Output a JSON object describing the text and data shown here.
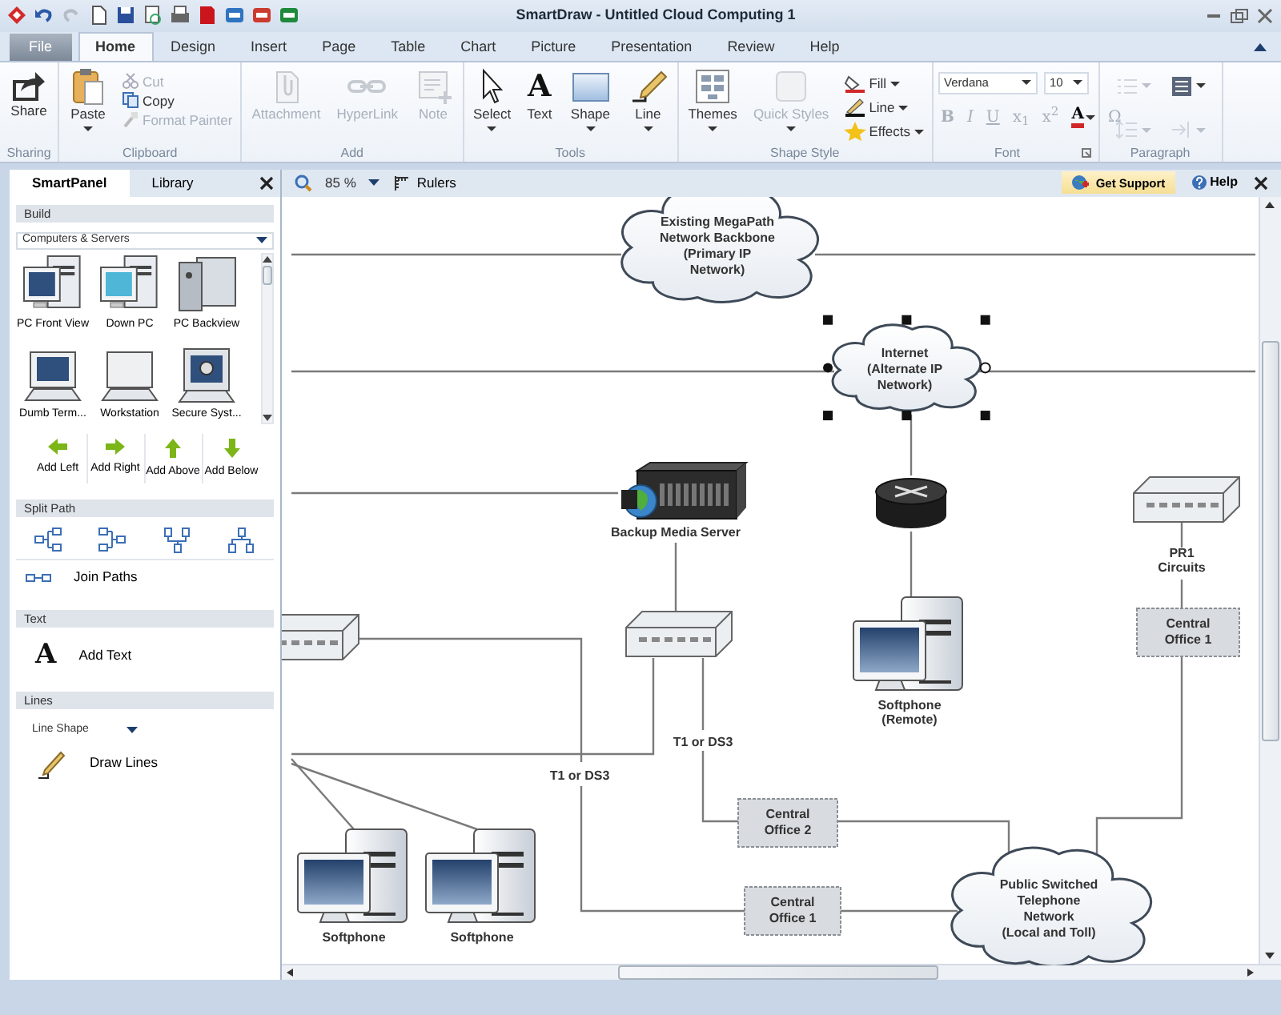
{
  "window": {
    "title": "SmartDraw - Untitled Cloud Computing 1"
  },
  "ribbon_tabs": [
    {
      "kind": "menu",
      "label": "File",
      "selected": false
    },
    {
      "kind": "tab",
      "label": "Home",
      "selected": true
    },
    {
      "kind": "tab",
      "label": "Design",
      "selected": false
    },
    {
      "kind": "tab",
      "label": "Insert",
      "selected": false
    },
    {
      "kind": "tab",
      "label": "Page",
      "selected": false
    },
    {
      "kind": "tab",
      "label": "Table",
      "selected": false
    },
    {
      "kind": "tab",
      "label": "Chart",
      "selected": false
    },
    {
      "kind": "tab",
      "label": "Picture",
      "selected": false
    },
    {
      "kind": "tab",
      "label": "Presentation",
      "selected": false
    },
    {
      "kind": "tab",
      "label": "Review",
      "selected": false
    },
    {
      "kind": "tab",
      "label": "Help",
      "selected": false
    }
  ],
  "ribbon_groups": [
    {
      "label": "Sharing",
      "items": [
        {
          "kind": "large",
          "label": "Share",
          "disabled": false,
          "dropdown": false
        }
      ]
    },
    {
      "label": "Clipboard",
      "items": [
        {
          "kind": "large",
          "label": "Paste",
          "disabled": false,
          "dropdown": true
        },
        {
          "kind": "small",
          "label": "Cut",
          "disabled": true,
          "dropdown": false
        },
        {
          "kind": "small",
          "label": "Copy",
          "disabled": false,
          "dropdown": false
        },
        {
          "kind": "small",
          "label": "Format Painter",
          "disabled": true,
          "dropdown": false
        }
      ]
    },
    {
      "label": "Add",
      "items": [
        {
          "kind": "large",
          "label": "Attachment",
          "disabled": true,
          "dropdown": false
        },
        {
          "kind": "large",
          "label": "HyperLink",
          "disabled": true,
          "dropdown": false
        },
        {
          "kind": "large",
          "label": "Note",
          "disabled": true,
          "dropdown": false
        }
      ]
    },
    {
      "label": "Tools",
      "items": [
        {
          "kind": "large",
          "label": "Select",
          "disabled": false,
          "dropdown": true
        },
        {
          "kind": "large",
          "label": "Text",
          "glyph": "A",
          "disabled": false,
          "dropdown": false
        },
        {
          "kind": "large",
          "label": "Shape",
          "disabled": false,
          "dropdown": true
        },
        {
          "kind": "large",
          "label": "Line",
          "disabled": false,
          "dropdown": true
        }
      ]
    },
    {
      "label": "Shape Style",
      "items": [
        {
          "kind": "large",
          "label": "Themes",
          "disabled": false,
          "dropdown": true
        },
        {
          "kind": "large",
          "label": "Quick Styles",
          "disabled": true,
          "dropdown": true
        },
        {
          "kind": "small",
          "label": "Fill",
          "disabled": false,
          "dropdown": true
        },
        {
          "kind": "small",
          "label": "Line",
          "disabled": false,
          "dropdown": true
        },
        {
          "kind": "small",
          "label": "Effects",
          "disabled": false,
          "dropdown": true
        }
      ]
    },
    {
      "label": "Font",
      "items": [
        {
          "kind": "select",
          "label": "Verdana"
        },
        {
          "kind": "select",
          "label": "10"
        },
        {
          "kind": "glyph",
          "label": "B",
          "disabled": true,
          "dropdown": false
        },
        {
          "kind": "glyph",
          "label": "I",
          "disabled": true,
          "dropdown": false
        },
        {
          "kind": "glyph",
          "label": "U",
          "disabled": true,
          "dropdown": false
        },
        {
          "kind": "glyph",
          "label": "x$_{1}$",
          "disabled": true,
          "dropdown": false
        },
        {
          "kind": "glyph",
          "label": "x$^{2}$",
          "disabled": true,
          "dropdown": false
        },
        {
          "kind": "glyph",
          "label": "A",
          "disabled": false,
          "dropdown": true
        },
        {
          "kind": "glyph",
          "label": "Ω",
          "disabled": true,
          "dropdown": false
        }
      ]
    },
    {
      "label": "Paragraph",
      "items": [
        {
          "kind": "icon",
          "disabled": true,
          "dropdown": true
        },
        {
          "kind": "icon",
          "disabled": false,
          "dropdown": true
        },
        {
          "kind": "icon",
          "disabled": true,
          "dropdown": true
        },
        {
          "kind": "icon",
          "disabled": true,
          "dropdown": true
        }
      ]
    }
  ],
  "panel": {
    "tabs": [
      {
        "label": "SmartPanel",
        "selected": true
      },
      {
        "label": "Library",
        "selected": false
      }
    ],
    "sections": [
      {
        "kind": "build",
        "title": "Build",
        "library": "Computers & Servers",
        "shapes": [
          {
            "label": "PC Front View"
          },
          {
            "label": "Down PC"
          },
          {
            "label": "PC Backview"
          },
          {
            "label": "Dumb Term..."
          },
          {
            "label": "Workstation"
          },
          {
            "label": "Secure Syst..."
          }
        ],
        "actions": [
          {
            "label": "Add Left"
          },
          {
            "label": "Add Right"
          },
          {
            "label": "Add Above"
          },
          {
            "label": "Add Below"
          }
        ]
      },
      {
        "kind": "split",
        "title": "Split Path",
        "command": "Join Paths"
      },
      {
        "kind": "text",
        "title": "Text",
        "glyph": "A",
        "command": "Add Text"
      },
      {
        "kind": "lines",
        "title": "Lines",
        "dropdown": "Line Shape",
        "command": "Draw Lines"
      }
    ]
  },
  "canvas_toolbar": {
    "zoom": "85 %",
    "rulers": "Rulers",
    "get_support": "Get Support",
    "help": "Help"
  },
  "diagram": {
    "nodes": [
      {
        "kind": "cloud",
        "label_lines": [
          "Existing MegaPath",
          "Network Backbone",
          "(Primary IP",
          "Network)"
        ],
        "selected": false
      },
      {
        "kind": "cloud",
        "label_lines": [
          "Internet",
          "(Alternate IP",
          "Network)"
        ],
        "selected": true
      },
      {
        "kind": "server",
        "label_lines": [
          "Backup Media Server"
        ],
        "selected": false
      },
      {
        "kind": "router",
        "selected": false
      },
      {
        "kind": "switch",
        "label_lines": [
          "PR1",
          "Circuits"
        ],
        "selected": false
      },
      {
        "kind": "switch",
        "selected": false
      },
      {
        "kind": "switch",
        "selected": false
      },
      {
        "kind": "pc",
        "label_lines": [
          "Softphone",
          "(Remote)"
        ],
        "selected": false
      },
      {
        "kind": "office",
        "label_lines": [
          "Central",
          "Office 1"
        ],
        "selected": false
      },
      {
        "kind": "text",
        "label_lines": [
          "T1 or DS3"
        ],
        "selected": false
      },
      {
        "kind": "text",
        "label_lines": [
          "T1 or DS3"
        ],
        "selected": false
      },
      {
        "kind": "office",
        "label_lines": [
          "Central",
          "Office 2"
        ],
        "selected": false
      },
      {
        "kind": "office",
        "label_lines": [
          "Central",
          "Office 1"
        ],
        "selected": false
      },
      {
        "kind": "pc",
        "label_lines": [
          "Softphone"
        ],
        "selected": false
      },
      {
        "kind": "pc",
        "label_lines": [
          "Softphone"
        ],
        "selected": false
      },
      {
        "kind": "cloud",
        "label_lines": [
          "Public Switched",
          "Telephone",
          "Network",
          "(Local and Toll)"
        ],
        "selected": false
      }
    ]
  }
}
